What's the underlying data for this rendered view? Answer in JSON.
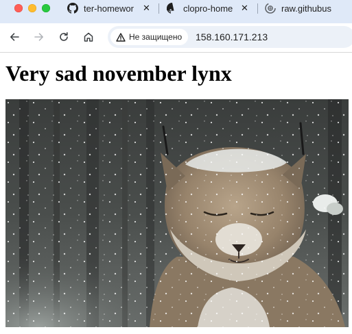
{
  "browser": {
    "tabs": [
      {
        "title": "ter-homewor",
        "icon": "github-icon"
      },
      {
        "title": "clopro-home",
        "icon": "github-icon"
      },
      {
        "title": "raw.githubus",
        "icon": "globe-loading-icon"
      }
    ],
    "close_glyph": "✕",
    "security_label": "Не защищено",
    "url": "158.160.171.213"
  },
  "page": {
    "heading": "Very sad november lynx",
    "image": {
      "subject": "lynx in snowfall",
      "alt": ""
    }
  },
  "colors": {
    "tab_strip_bg": "#dfe9f8",
    "omnibox_bg": "#ecf1f8",
    "close_red": "#fe5f57",
    "minimize_yellow": "#febc2e",
    "zoom_green": "#28c840"
  }
}
